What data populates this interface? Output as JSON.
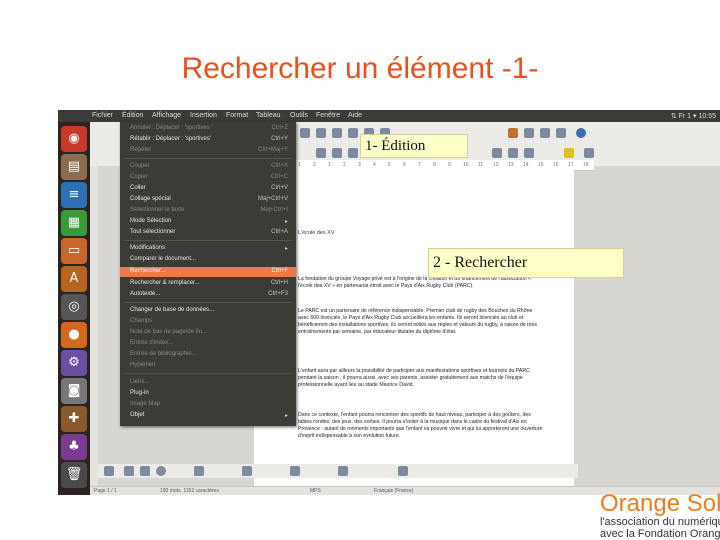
{
  "slide": {
    "title": "Rechercher un élément -1-"
  },
  "menubar": {
    "items": [
      "Fichier",
      "Édition",
      "Affichage",
      "Insertion",
      "Format",
      "Tableau",
      "Outils",
      "Fenêtre",
      "Aide"
    ],
    "tray": "⇅ Fr 1 ▾ 10:55"
  },
  "launcher": {
    "icons": [
      "ubuntu-dash-icon",
      "files-icon",
      "writer-icon",
      "calc-icon",
      "impress-icon",
      "software-icon",
      "chrome-icon",
      "firefox-icon",
      "settings-icon",
      "camera-icon",
      "tools-icon",
      "game-icon",
      "trash-icon"
    ]
  },
  "edit_menu": {
    "items": [
      {
        "label": "Annuler : Déplacer : 'sportives '",
        "shortcut": "Ctrl+Z",
        "disabled": true
      },
      {
        "label": "Rétablir : Déplacer : 'sportives'",
        "shortcut": "Ctrl+Y",
        "disabled": false
      },
      {
        "label": "Répéter",
        "shortcut": "Ctrl+Maj+Y",
        "disabled": true
      },
      {
        "label": "Couper",
        "shortcut": "Ctrl+X",
        "disabled": true
      },
      {
        "label": "Copier",
        "shortcut": "Ctrl+C",
        "disabled": true
      },
      {
        "label": "Coller",
        "shortcut": "Ctrl+V",
        "disabled": false
      },
      {
        "label": "Collage spécial",
        "shortcut": "Maj+Ctrl+V",
        "disabled": false
      },
      {
        "label": "Sélectionner le texte",
        "shortcut": "Maj+Ctrl+I",
        "disabled": true
      },
      {
        "label": "Mode Sélection",
        "shortcut": "▸",
        "disabled": false
      },
      {
        "label": "Tout sélectionner",
        "shortcut": "Ctrl+A",
        "disabled": false
      },
      {
        "label": "Modifications",
        "shortcut": "▸",
        "disabled": false
      },
      {
        "label": "Comparer le document...",
        "shortcut": "",
        "disabled": false
      },
      {
        "label": "Rechercher...",
        "shortcut": "Ctrl+F",
        "disabled": false,
        "highlighted": true
      },
      {
        "label": "Rechercher & remplacer...",
        "shortcut": "Ctrl+H",
        "disabled": false
      },
      {
        "label": "Autotexte...",
        "shortcut": "Ctrl+F3",
        "disabled": false
      },
      {
        "label": "Changer de base de données...",
        "shortcut": "",
        "disabled": false
      },
      {
        "label": "Champs",
        "shortcut": "",
        "disabled": true
      },
      {
        "label": "Note de bas de page/de fin...",
        "shortcut": "",
        "disabled": true
      },
      {
        "label": "Entrée d'index...",
        "shortcut": "",
        "disabled": true
      },
      {
        "label": "Entrée de bibliographie...",
        "shortcut": "",
        "disabled": true
      },
      {
        "label": "Hyperlien",
        "shortcut": "",
        "disabled": true
      },
      {
        "label": "Liens...",
        "shortcut": "",
        "disabled": true
      },
      {
        "label": "Plug-in",
        "shortcut": "",
        "disabled": false
      },
      {
        "label": "Image Map",
        "shortcut": "",
        "disabled": true
      },
      {
        "label": "Objet",
        "shortcut": "▸",
        "disabled": false
      }
    ]
  },
  "callouts": {
    "edition": "1- Édition",
    "rechercher": "2 - Rechercher"
  },
  "document": {
    "heading": "L'école des XV",
    "p1": "La fondation du groupe Voyage privé est à l'origine de la création et du financement de l'association « l'école des XV » en partenariat étroit avec le Pays d'Aix Rugby Club (PARC).",
    "p2": "Le PARC est un partenaire de référence indispensable. Premier club de rugby des Bouches du Rhône avec 600 licenciés, le Pays d'Aix Rugby Club accueillera les enfants. Ils seront licenciés au club et bénéficieront des installations sportives, ils seront initiés aux règles et valeurs du rugby, à raison de trois entraînements par semaine, par éducateur titulaire du diplôme d'état.",
    "p3": "L'enfant aura par ailleurs la possibilité de participer aux manifestations sportives et tournois du PARC pendant la saison ; il pourra aussi, avec ses parents, assister gratuitement aux matchs de l'équipe professionnelle ayant lieu au stade Maurice David.",
    "p4": "Dans ce contexte, l'enfant pourra rencontrer des sportifs de haut niveau, participer à des goûters, des tables rondes, des jeux, des sorties. Il pourra s'initier à la musique dans le cadre du festival d'Aix en Provence : autant de moments importants que l'enfant va pouvoir vivre et qui lui apporteront une ouverture d'esprit indispensable à son évolution future."
  },
  "statusbar": {
    "page": "Page 1 / 1",
    "words": "190 mots, 1152 caractères",
    "style": "MPS",
    "lang": "Français (France)"
  },
  "ruler": {
    "ticks": [
      "1",
      "2",
      "1",
      "2",
      "3",
      "4",
      "5",
      "6",
      "7",
      "8",
      "9",
      "10",
      "11",
      "12",
      "13",
      "14",
      "15",
      "16",
      "17",
      "18"
    ]
  },
  "branding": {
    "name": "Orange Solid",
    "line1": "l'association du numériqu",
    "line2": "avec la Fondation Orange"
  },
  "colors": {
    "title": "#e8501c",
    "highlight": "#f07746",
    "menu_bg": "#3c3b37",
    "callout_bg": "#ffffc8",
    "brand": "#f07c1a"
  }
}
